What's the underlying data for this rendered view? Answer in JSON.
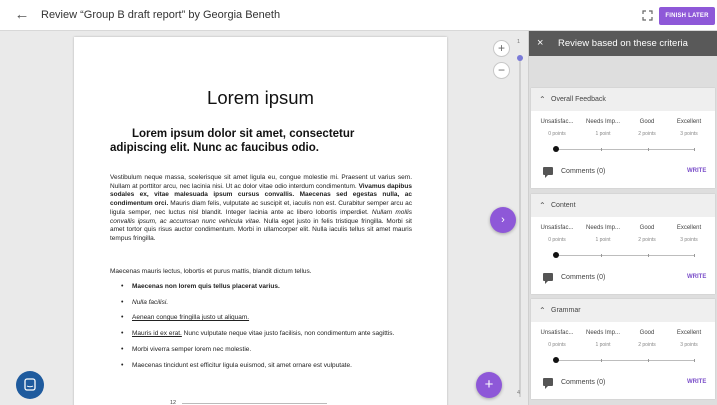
{
  "header": {
    "back_icon": "arrow-left-icon",
    "title": "Review “Group B draft report” by Georgia Beneth",
    "fullscreen_icon": "fullscreen-icon",
    "finish_label": "FINISH LATER",
    "accent_color": "#8e58d8"
  },
  "document": {
    "heading": "Lorem ipsum",
    "subheading": "Lorem ipsum dolor sit amet, consectetur adipiscing elit. Nunc ac faucibus odio.",
    "para1_a": "Vestibulum neque massa, scelerisque sit amet ligula eu, congue molestie mi. Praesent ut varius sem. Nullam at porttitor arcu, nec lacinia nisi. Ut ac dolor vitae odio interdum condimentum. ",
    "para1_b": "Vivamus dapibus sodales ex, vitae malesuada ipsum cursus convallis. Maecenas sed egestas nulla, ac condimentum orci.",
    "para1_c": " Mauris diam felis, vulputate ac suscipit et, iaculis non est. Curabitur semper arcu ac ligula semper, nec luctus nisl blandit. Integer lacinia ante ac libero lobortis imperdiet. ",
    "para1_d": "Nullam mollis convallis ipsum, ac accumsan nunc vehicula vitae.",
    "para1_e": " Nulla eget justo in felis tristique fringilla. Morbi sit amet tortor quis risus auctor condimentum. Morbi in ullamcorper elit. Nulla iaculis tellus sit amet mauris tempus fringilla.",
    "para2": "Maecenas mauris lectus, lobortis et purus mattis, blandit dictum tellus.",
    "list": [
      "Maecenas non lorem quis tellus placerat varius.",
      "Nulla facilisi.",
      "Aenean congue fringilla justo ut aliquam.",
      "Mauris id ex erat.",
      " Nunc vulputate neque vitae justo facilisis, non condimentum ante sagittis.",
      "Morbi viverra semper lorem nec molestie.",
      "Maecenas tincidunt est efficitur ligula euismod, sit amet ornare est vulputate."
    ],
    "chart_tick": "12",
    "page_top": "1",
    "page_bottom": "4"
  },
  "controls": {
    "zoom_in": "+",
    "zoom_out": "−",
    "next": "›",
    "add": "+"
  },
  "panel": {
    "close": "×",
    "title": "Review based on these criteria",
    "criteria": [
      {
        "name": "Overall Feedback",
        "levels": [
          {
            "name": "Unsatisfac...",
            "points": "0 points"
          },
          {
            "name": "Needs Imp...",
            "points": "1 point"
          },
          {
            "name": "Good",
            "points": "2 points"
          },
          {
            "name": "Excellent",
            "points": "3 points"
          }
        ],
        "selected": 0,
        "comments": "Comments (0)",
        "write": "WRITE"
      },
      {
        "name": "Content",
        "levels": [
          {
            "name": "Unsatisfac...",
            "points": "0 points"
          },
          {
            "name": "Needs Imp...",
            "points": "1 point"
          },
          {
            "name": "Good",
            "points": "2 points"
          },
          {
            "name": "Excellent",
            "points": "3 points"
          }
        ],
        "selected": 0,
        "comments": "Comments (0)",
        "write": "WRITE"
      },
      {
        "name": "Grammar",
        "levels": [
          {
            "name": "Unsatisfac...",
            "points": "0 points"
          },
          {
            "name": "Needs Imp...",
            "points": "1 point"
          },
          {
            "name": "Good",
            "points": "2 points"
          },
          {
            "name": "Excellent",
            "points": "3 points"
          }
        ],
        "selected": 0,
        "comments": "Comments (0)",
        "write": "WRITE"
      }
    ]
  }
}
